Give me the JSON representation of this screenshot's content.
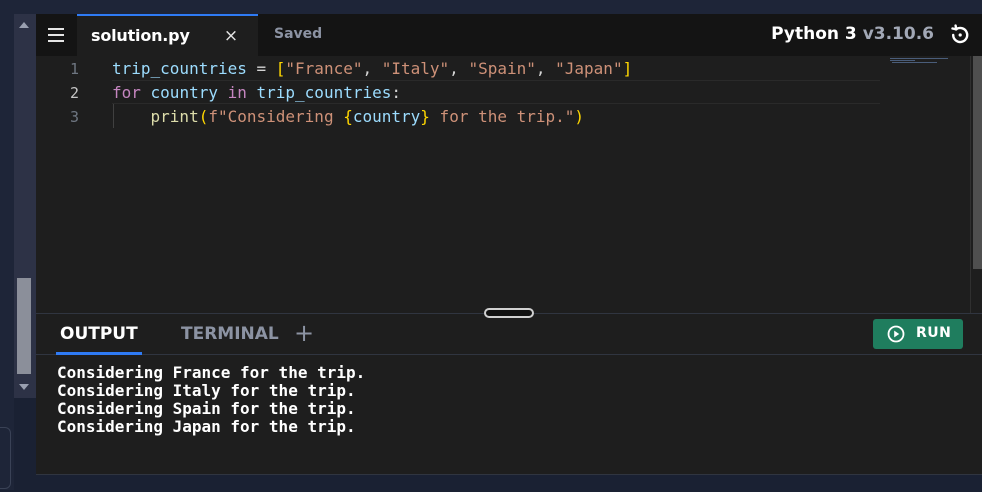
{
  "tabbar": {
    "file_name": "solution.py",
    "close_glyph": "×",
    "status": "Saved",
    "language": "Python 3",
    "version": "v3.10.6"
  },
  "editor": {
    "line_numbers": [
      "1",
      "2",
      "3"
    ],
    "lines": [
      [
        {
          "text": "trip_countries",
          "kind": "var"
        },
        {
          "text": " = ",
          "kind": "op"
        },
        {
          "text": "[",
          "kind": "br"
        },
        {
          "text": "\"France\"",
          "kind": "str"
        },
        {
          "text": ", ",
          "kind": "op"
        },
        {
          "text": "\"Italy\"",
          "kind": "str"
        },
        {
          "text": ", ",
          "kind": "op"
        },
        {
          "text": "\"Spain\"",
          "kind": "str"
        },
        {
          "text": ", ",
          "kind": "op"
        },
        {
          "text": "\"Japan\"",
          "kind": "str"
        },
        {
          "text": "]",
          "kind": "br"
        }
      ],
      [
        {
          "text": "for",
          "kind": "kw"
        },
        {
          "text": " country ",
          "kind": "var"
        },
        {
          "text": "in",
          "kind": "kw"
        },
        {
          "text": " trip_countries",
          "kind": "var"
        },
        {
          "text": ":",
          "kind": "op"
        }
      ],
      [
        {
          "text": "    ",
          "kind": "op"
        },
        {
          "text": "print",
          "kind": "fn"
        },
        {
          "text": "(",
          "kind": "br"
        },
        {
          "text": "f\"Considering ",
          "kind": "str"
        },
        {
          "text": "{",
          "kind": "br"
        },
        {
          "text": "country",
          "kind": "var"
        },
        {
          "text": "}",
          "kind": "br"
        },
        {
          "text": " for the trip.\"",
          "kind": "str"
        },
        {
          "text": ")",
          "kind": "br"
        }
      ]
    ]
  },
  "panel": {
    "tabs": [
      "OUTPUT",
      "TERMINAL"
    ],
    "add_glyph": "+",
    "run_label": "RUN",
    "output_lines": [
      "Considering France for the trip.",
      "Considering Italy for the trip.",
      "Considering Spain for the trip.",
      "Considering Japan for the trip."
    ]
  },
  "colors": {
    "accent": "#2f7bf5",
    "run_button": "#1f7d5e",
    "keyword": "#c586c0",
    "string": "#ce9178",
    "variable": "#9cdcfe",
    "function": "#dcdcaa",
    "bracket": "#ffd700"
  },
  "icons": {
    "menu": "hamburger-menu-icon",
    "close": "close-icon",
    "reset": "reset-icon",
    "add": "plus-icon",
    "run": "play-circle-icon"
  }
}
